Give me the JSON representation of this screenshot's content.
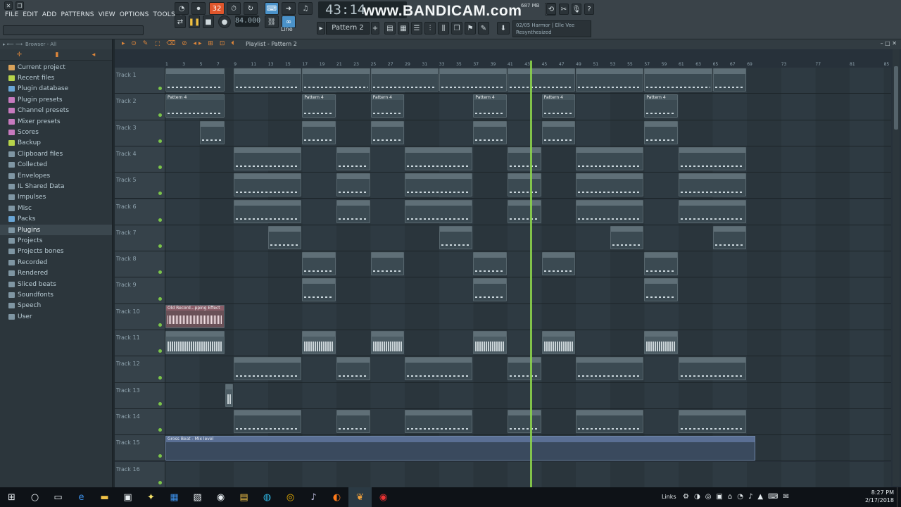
{
  "menu": [
    "FILE",
    "EDIT",
    "ADD",
    "PATTERNS",
    "VIEW",
    "OPTIONS",
    "TOOLS",
    "?"
  ],
  "transport": {
    "pattern_indicator": "32",
    "tempo": "84.000",
    "time": "43:14",
    "watermark": "www.BANDICAM.com",
    "memory": "687 MB",
    "pattern_selector": "Pattern 2",
    "snap": "Line"
  },
  "hint": {
    "line1": "02/05  Harmor | Elle Vee",
    "line2": "Resynthesized"
  },
  "browser": {
    "header": "Browser - All",
    "items": [
      {
        "label": "Current project",
        "icon_color": "#d9a25a"
      },
      {
        "label": "Recent files",
        "icon_color": "#b6d34a"
      },
      {
        "label": "Plugin database",
        "icon_color": "#6aa6d6"
      },
      {
        "label": "Plugin presets",
        "icon_color": "#c77abf"
      },
      {
        "label": "Channel presets",
        "icon_color": "#c77abf"
      },
      {
        "label": "Mixer presets",
        "icon_color": "#c77abf"
      },
      {
        "label": "Scores",
        "icon_color": "#c77abf"
      },
      {
        "label": "Backup",
        "icon_color": "#b6d34a"
      },
      {
        "label": "Clipboard files",
        "icon_color": "#7f96a3"
      },
      {
        "label": "Collected",
        "icon_color": "#7f96a3"
      },
      {
        "label": "Envelopes",
        "icon_color": "#7f96a3"
      },
      {
        "label": "IL Shared Data",
        "icon_color": "#7f96a3"
      },
      {
        "label": "Impulses",
        "icon_color": "#7f96a3"
      },
      {
        "label": "Misc",
        "icon_color": "#7f96a3"
      },
      {
        "label": "Packs",
        "icon_color": "#6aa6d6"
      },
      {
        "label": "Plugins",
        "icon_color": "#7f96a3",
        "selected": true
      },
      {
        "label": "Projects",
        "icon_color": "#7f96a3"
      },
      {
        "label": "Projects bones",
        "icon_color": "#7f96a3"
      },
      {
        "label": "Recorded",
        "icon_color": "#7f96a3"
      },
      {
        "label": "Rendered",
        "icon_color": "#7f96a3"
      },
      {
        "label": "Sliced beats",
        "icon_color": "#7f96a3"
      },
      {
        "label": "Soundfonts",
        "icon_color": "#7f96a3"
      },
      {
        "label": "Speech",
        "icon_color": "#7f96a3"
      },
      {
        "label": "User",
        "icon_color": "#7f96a3"
      }
    ]
  },
  "playlist": {
    "title": "Playlist - Pattern 2",
    "ruler": [
      "1",
      "3",
      "5",
      "7",
      "9",
      "11",
      "13",
      "15",
      "17",
      "19",
      "21",
      "23",
      "25",
      "27",
      "29",
      "31",
      "33",
      "35",
      "37",
      "39",
      "41",
      "43",
      "45",
      "47",
      "49",
      "51",
      "53",
      "55",
      "57",
      "59",
      "61",
      "63",
      "65",
      "67",
      "69",
      "73",
      "77",
      "81",
      "85"
    ],
    "tracks": [
      "Track 1",
      "Track 2",
      "Track 3",
      "Track 4",
      "Track 5",
      "Track 6",
      "Track 7",
      "Track 8",
      "Track 9",
      "Track 10",
      "Track 11",
      "Track 12",
      "Track 13",
      "Track 14",
      "Track 15",
      "Track 16"
    ],
    "clip_labels": {
      "pattern4": "Pattern 4",
      "oldrec": "Old Record...pping Effect",
      "gross": "Gross Beat - Mix level"
    }
  },
  "taskbar": {
    "links": "Links",
    "time": "8:27 PM",
    "date": "2/17/2018"
  }
}
